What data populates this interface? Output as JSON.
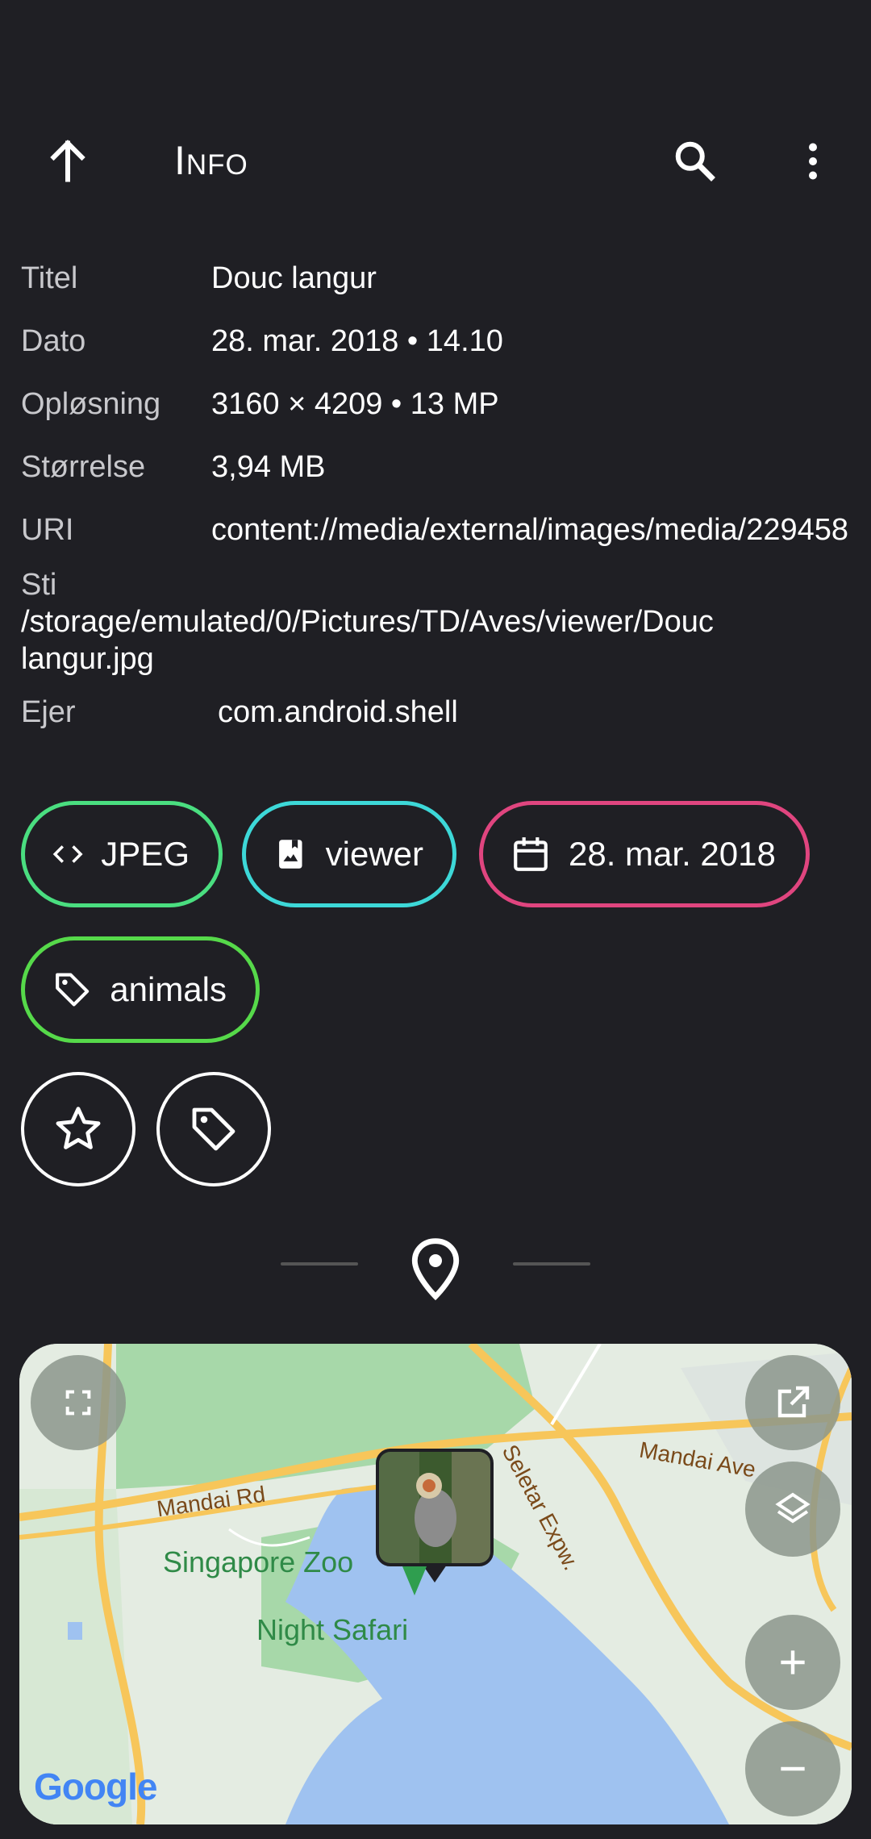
{
  "appbar": {
    "title": "Info",
    "back_icon": "arrow-up-icon",
    "search_icon": "search-icon",
    "more_icon": "more-vert-icon"
  },
  "info": {
    "title_label": "Titel",
    "title_value": "Douc langur",
    "date_label": "Dato",
    "date_value": "28. mar. 2018 • 14.10",
    "resolution_label": "Opløsning",
    "resolution_value": "3160 × 4209 • 13 MP",
    "size_label": "Størrelse",
    "size_value": "3,94 MB",
    "uri_label": "URI",
    "uri_value": "content://media/external/images/media/229458",
    "path_label": "Sti",
    "path_value": "/storage/emulated/0/Pictures/TD/Aves/viewer/Douc langur.jpg",
    "owner_label": "Ejer",
    "owner_value": "com.android.shell"
  },
  "chips": {
    "format": "JPEG",
    "album": "viewer",
    "date": "28. mar. 2018",
    "tag": "animals",
    "colors": {
      "format": "#4ade80",
      "album": "#3dd8d8",
      "date": "#e0457f",
      "tag": "#56d94a"
    }
  },
  "map": {
    "labels": {
      "zoo": "Singapore Zoo",
      "safari": "Night Safari",
      "mandai_rd": "Mandai Rd",
      "mandai_ave": "Mandai Ave",
      "seletar": "Seletar Expw.",
      "google": "Google"
    }
  }
}
